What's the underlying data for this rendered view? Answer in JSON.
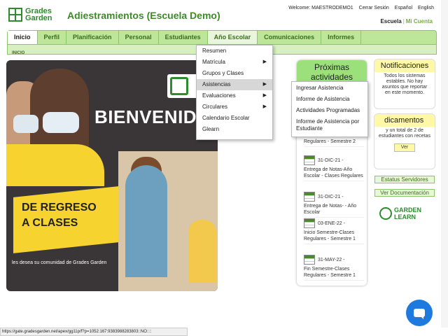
{
  "header": {
    "logo_line1": "Grades",
    "logo_line2": "Garden",
    "title": "Adiestramientos (Escuela Demo)",
    "welcome": "Welcome: MAESTRODEMO1",
    "logout": "Cerrar Sesión",
    "spanish": "Español",
    "english": "English",
    "school": "Escuela",
    "my_account": "Mi Cuenta"
  },
  "nav": {
    "tabs": [
      "Inicio",
      "Perfil",
      "Planificación",
      "Personal",
      "Estudiantes",
      "Año Escolar",
      "Comunicaciones",
      "Informes"
    ],
    "breadcrumb": "INICIO"
  },
  "menu": {
    "items": [
      {
        "label": "Resumen",
        "arrow": ""
      },
      {
        "label": "Matrícula",
        "arrow": "▶"
      },
      {
        "label": "Grupos y Clases",
        "arrow": ""
      },
      {
        "label": "Asistencias",
        "arrow": "▶"
      },
      {
        "label": "Evaluaciones",
        "arrow": "▶"
      },
      {
        "label": "Circulares",
        "arrow": "▶"
      },
      {
        "label": "Calendario Escolar",
        "arrow": ""
      },
      {
        "label": "Glearn",
        "arrow": ""
      }
    ],
    "submenu": [
      "Ingresar Asistencia",
      "Informe de Asistencia",
      "Actividades Programadas",
      "Informe de Asistencia por Estudiante"
    ]
  },
  "banner": {
    "title": "BIENVENIDO",
    "subtitle_line1": "DE REGRESO",
    "subtitle_line2": "A CLASES",
    "caption": "les desea su comunidad de Grades Garden"
  },
  "activities": {
    "title_line1": "Próximas",
    "title_line2": "actividades",
    "partial_top": "Regulares - Semestre 2",
    "items": [
      {
        "date": "31-DIC-21 -",
        "text": "Entrega de Notas-Año Escolar - Clases Regulares"
      },
      {
        "date": "31-DIC-21 -",
        "text": "Entrega de Notas- - Año Escolar"
      },
      {
        "date": "03-ENE-22 -",
        "text": "Inicio Semestre-Clases Regulares - Semestre 1"
      },
      {
        "date": "31-MAY-22 -",
        "text": "Fin Semestre-Clases Regulares - Semestre 1"
      }
    ]
  },
  "notifications": {
    "title": "Notificaciones",
    "body": "Todos los sistemas estables. No hay asuntos que reportar en este momento."
  },
  "meds": {
    "title": "dicamentos",
    "body": "y un total de 2 de estudiantes con recetas",
    "button": "Ver"
  },
  "side": {
    "server_status": "Estatus Servidores",
    "docs": "Ver Documentación",
    "garden_learn_1": "GARDEN",
    "garden_learn_2": "LEARN"
  },
  "statusbar": {
    "url": "https://gate.gradesgarden.net/apex/gg11p/f?p=1052:167:9383988283803::NO::::"
  },
  "colors": {
    "brand_green": "#3d8b27",
    "nav_green": "#bde69a",
    "notif_yellow": "#fff8a6",
    "chat_blue": "#1f7ae0"
  }
}
